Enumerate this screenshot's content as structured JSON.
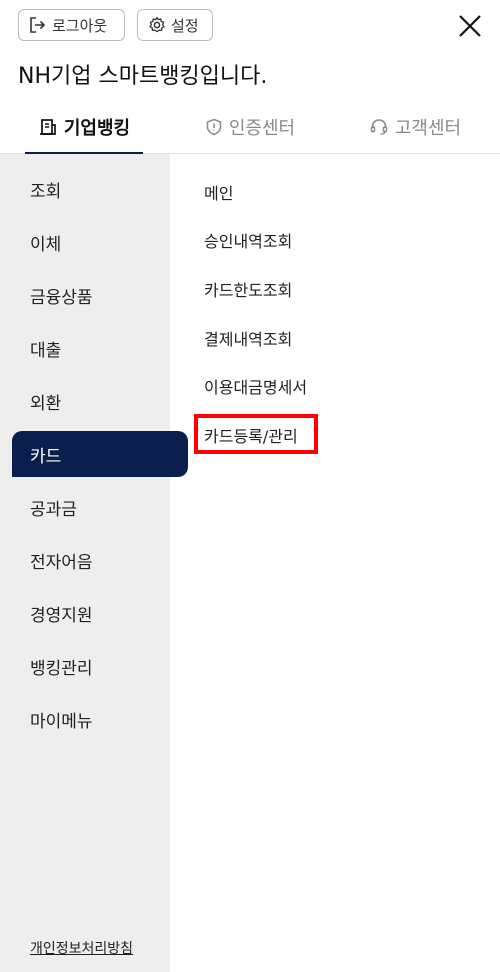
{
  "header": {
    "logout_label": "로그아웃",
    "settings_label": "설정",
    "close_icon": "close-icon",
    "greeting": "NH기업 스마트뱅킹입니다."
  },
  "tabs": [
    {
      "label": "기업뱅킹",
      "icon": "building-icon",
      "active": true
    },
    {
      "label": "인증센터",
      "icon": "shield-icon",
      "active": false
    },
    {
      "label": "고객센터",
      "icon": "headset-icon",
      "active": false
    }
  ],
  "sidebar": {
    "items": [
      "조회",
      "이체",
      "금융상품",
      "대출",
      "외환",
      "카드",
      "공과금",
      "전자어음",
      "경영지원",
      "뱅킹관리",
      "마이메뉴"
    ],
    "active_index": 5,
    "privacy_link": "개인정보처리방침"
  },
  "submenu": {
    "items": [
      "메인",
      "승인내역조회",
      "카드한도조회",
      "결제내역조회",
      "이용대금명세서",
      "카드등록/관리"
    ],
    "highlighted_index": 5
  },
  "colors": {
    "accent": "#0b1f4f",
    "highlight": "#ff0000",
    "sidebar_bg": "#eeeeee"
  }
}
